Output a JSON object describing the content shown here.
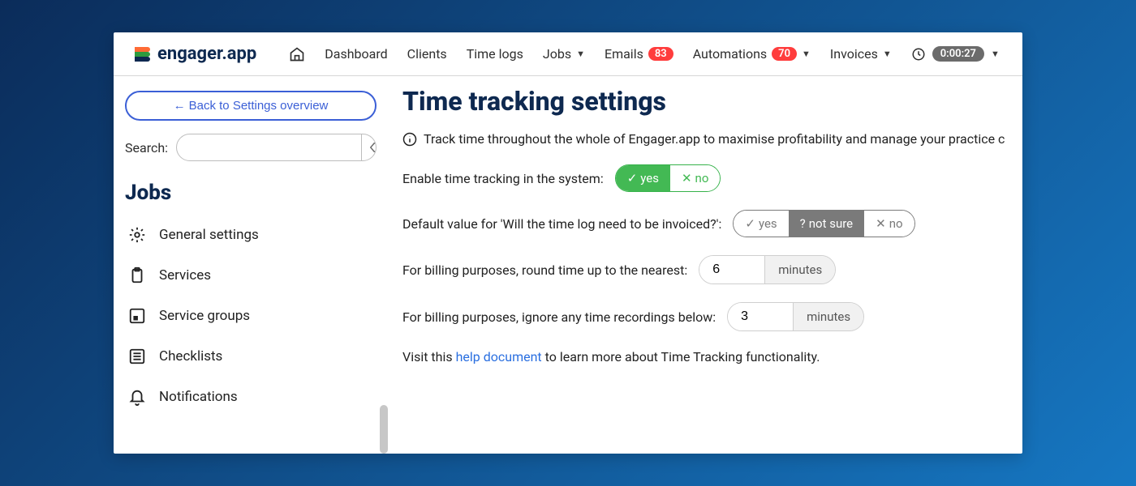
{
  "brand": {
    "name": "engager.app"
  },
  "nav": {
    "dashboard": "Dashboard",
    "clients": "Clients",
    "timelogs": "Time logs",
    "jobs": "Jobs",
    "emails": {
      "label": "Emails",
      "badge": "83"
    },
    "automations": {
      "label": "Automations",
      "badge": "70"
    },
    "invoices": "Invoices",
    "timer": "0:00:27"
  },
  "sidebar": {
    "back": "Back to Settings overview",
    "search_label": "Search:",
    "group": "Jobs",
    "items": [
      {
        "label": "General settings"
      },
      {
        "label": "Services"
      },
      {
        "label": "Service groups"
      },
      {
        "label": "Checklists"
      },
      {
        "label": "Notifications"
      }
    ]
  },
  "page": {
    "title": "Time tracking settings",
    "intro": "Track time throughout the whole of Engager.app to maximise profitability and manage your practice c",
    "enable_label": "Enable time tracking in the system:",
    "toggle": {
      "yes": "yes",
      "no": "no"
    },
    "default_label": "Default value for 'Will the time log need to be invoiced?':",
    "tri": {
      "yes": "yes",
      "notsure": "not sure",
      "no": "no"
    },
    "round_label": "For billing purposes, round time up to the nearest:",
    "round_value": "6",
    "ignore_label": "For billing purposes, ignore any time recordings below:",
    "ignore_value": "3",
    "unit": "minutes",
    "help_prefix": "Visit this ",
    "help_link": "help document",
    "help_suffix": " to learn more about Time Tracking functionality."
  }
}
